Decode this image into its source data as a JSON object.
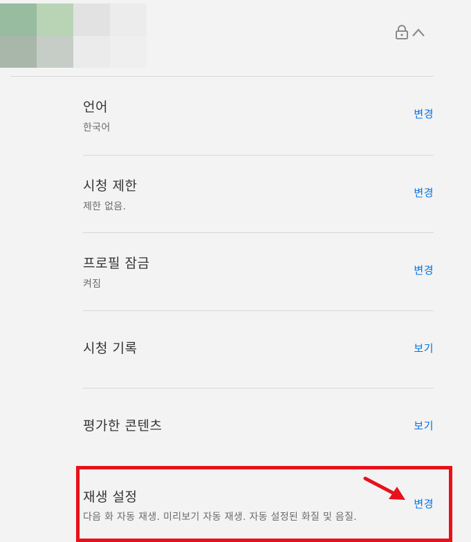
{
  "avatar": {
    "tiles": [
      "#97bc9f",
      "#b8d4b5",
      "#e2e2e2",
      "#ececec",
      "#a9b7ab",
      "#c6cdc7",
      "#ebebeb",
      "#efefef"
    ]
  },
  "header": {
    "icons": [
      "lock-icon",
      "chevron-up-icon"
    ]
  },
  "settings": {
    "rows": [
      {
        "title": "언어",
        "subtitle": "한국어",
        "action": "변경"
      },
      {
        "title": "시청 제한",
        "subtitle": "제한 없음.",
        "action": "변경"
      },
      {
        "title": "프로필 잠금",
        "subtitle": "켜짐",
        "action": "변경"
      },
      {
        "title": "시청 기록",
        "subtitle": "",
        "action": "보기"
      },
      {
        "title": "평가한 콘텐츠",
        "subtitle": "",
        "action": "보기"
      },
      {
        "title": "재생 설정",
        "subtitle": "다음 화 자동 재생. 미리보기 자동 재생. 자동 설정된 화질 및 음질.",
        "action": "변경"
      }
    ]
  },
  "annotation": {
    "highlight_color": "#e8101a",
    "highlighted_row": "재생 설정"
  },
  "colors": {
    "background": "#f3f3f3",
    "link": "#0073e6",
    "divider": "#d7d7d7"
  }
}
